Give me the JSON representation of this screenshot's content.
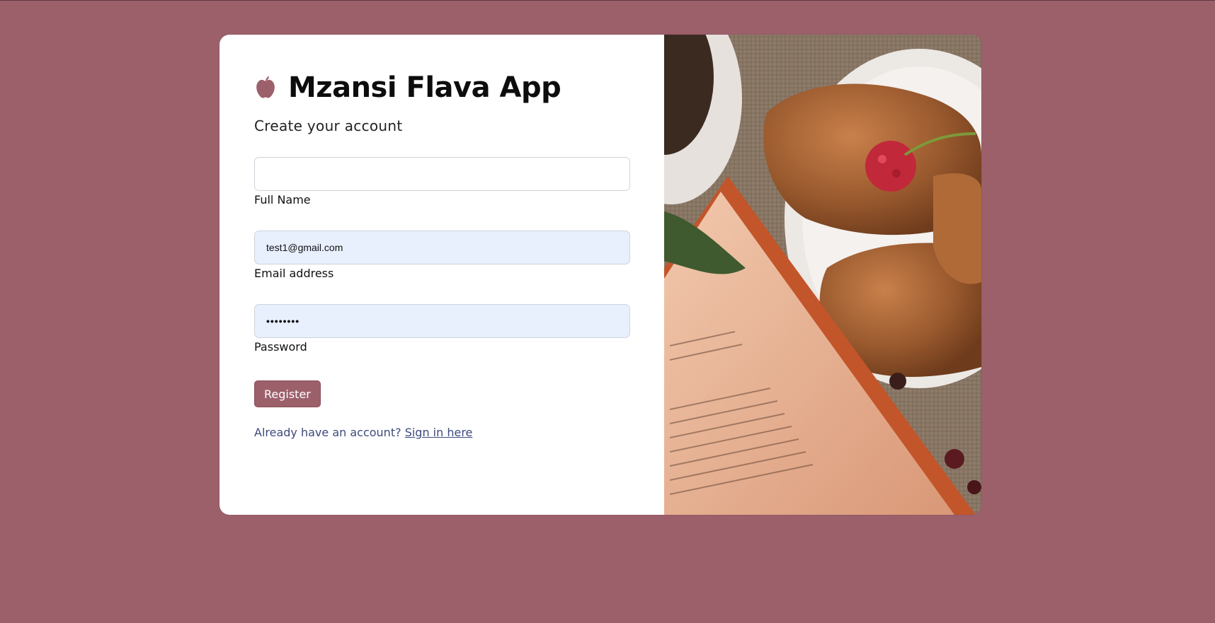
{
  "app": {
    "title": "Mzansi Flava App",
    "icon": "apple-icon",
    "subtitle": "Create your account"
  },
  "form": {
    "full_name": {
      "value": "",
      "label": "Full Name"
    },
    "email": {
      "value": "test1@gmail.com",
      "label": "Email address"
    },
    "password": {
      "value": "••••••••",
      "label": "Password"
    },
    "register_label": "Register"
  },
  "footer": {
    "prompt": "Already have an account?",
    "link_label": "Sign in here"
  },
  "colors": {
    "background": "#9c606b",
    "accent": "#9c606b",
    "link": "#3d4a7c",
    "autofill": "#e8f0fe"
  }
}
